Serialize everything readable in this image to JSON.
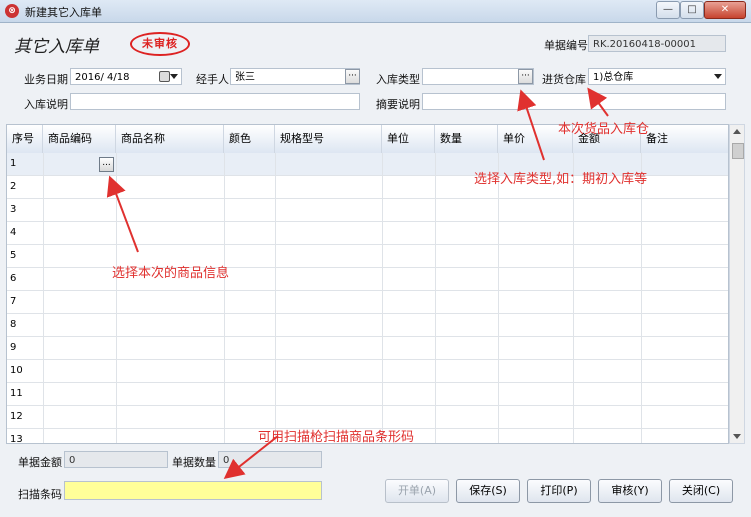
{
  "window": {
    "title": "新建其它入库单",
    "controls": {
      "minimize": "—",
      "maximize": "□",
      "close": "✕"
    }
  },
  "form": {
    "title": "其它入库单",
    "status_stamp": "未审核",
    "doc_no_label": "单据编号",
    "doc_no_value": "RK.20160418-00001"
  },
  "fields": {
    "biz_date_label": "业务日期",
    "biz_date_value": "2016/ 4/18",
    "handler_label": "经手人",
    "handler_value": "张三",
    "in_type_label": "入库类型",
    "in_type_value": "",
    "warehouse_label": "进货仓库",
    "warehouse_value": "1)总仓库",
    "in_note_label": "入库说明",
    "in_note_value": "",
    "summary_label": "摘要说明",
    "summary_value": ""
  },
  "grid": {
    "columns": [
      "序号",
      "商品编码",
      "商品名称",
      "颜色",
      "规格型号",
      "单位",
      "数量",
      "单价",
      "金额",
      "备注"
    ],
    "row_numbers": [
      "1",
      "2",
      "3",
      "4",
      "5",
      "6",
      "7",
      "8",
      "9",
      "10",
      "11",
      "12",
      "13"
    ],
    "cell_button": "..."
  },
  "footer": {
    "total_amount_label": "单据金额",
    "total_amount_value": "0",
    "total_qty_label": "单据数量",
    "total_qty_value": "0",
    "scan_label": "扫描条码",
    "scan_value": ""
  },
  "buttons": {
    "open": "开单(A)",
    "save": "保存(S)",
    "print": "打印(P)",
    "audit": "审核(Y)",
    "close": "关闭(C)"
  },
  "annotations": {
    "warehouse_hint": "本次货品入库仓",
    "type_hint": "选择入库类型,如：期初入库等",
    "product_hint": "选择本次的商品信息",
    "scan_hint": "可用扫描枪扫描商品条形码"
  },
  "colors": {
    "annotation_red": "#e0312f",
    "stamp_red": "#d22222",
    "scan_field_yellow": "#ffff99",
    "header_blue": "#dde6f2"
  }
}
